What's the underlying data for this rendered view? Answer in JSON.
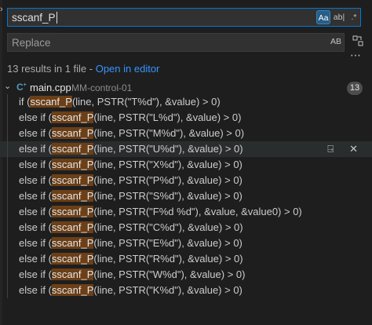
{
  "search": {
    "value": "sscanf_P",
    "options": [
      "Aa",
      "ab|",
      ".*"
    ]
  },
  "replace": {
    "placeholder": "Replace",
    "preserve_case": "AB"
  },
  "summary": {
    "text": "13 results in 1 file - ",
    "link": "Open in editor"
  },
  "file": {
    "name": "main.cpp",
    "path": "MM-control-01",
    "count": "13",
    "icon": "cpp-file-icon"
  },
  "results": [
    {
      "prefix": "if (",
      "match": "sscanf_P",
      "suffix": "(line, PSTR(\"T%d\"), &value) > 0)"
    },
    {
      "prefix": "else if (",
      "match": "sscanf_P",
      "suffix": "(line, PSTR(\"L%d\"), &value) > 0)"
    },
    {
      "prefix": "else if (",
      "match": "sscanf_P",
      "suffix": "(line, PSTR(\"M%d\"), &value) > 0)"
    },
    {
      "prefix": "else if (",
      "match": "sscanf_P",
      "suffix": "(line, PSTR(\"U%d\"), &value) > 0)"
    },
    {
      "prefix": "else if (",
      "match": "sscanf_P",
      "suffix": "(line, PSTR(\"X%d\"), &value) > 0)"
    },
    {
      "prefix": "else if (",
      "match": "sscanf_P",
      "suffix": "(line, PSTR(\"P%d\"), &value) > 0)"
    },
    {
      "prefix": "else if (",
      "match": "sscanf_P",
      "suffix": "(line, PSTR(\"S%d\"), &value) > 0)"
    },
    {
      "prefix": "else if (",
      "match": "sscanf_P",
      "suffix": "(line, PSTR(\"F%d %d\"), &value, &value0) > 0)"
    },
    {
      "prefix": "else if (",
      "match": "sscanf_P",
      "suffix": "(line, PSTR(\"C%d\"), &value) > 0)"
    },
    {
      "prefix": "else if (",
      "match": "sscanf_P",
      "suffix": "(line, PSTR(\"E%d\"), &value) > 0)"
    },
    {
      "prefix": "else if (",
      "match": "sscanf_P",
      "suffix": "(line, PSTR(\"R%d\"), &value) > 0)"
    },
    {
      "prefix": "else if (",
      "match": "sscanf_P",
      "suffix": "(line, PSTR(\"W%d\"), &value) > 0)"
    },
    {
      "prefix": "else if (",
      "match": "sscanf_P",
      "suffix": "(line, PSTR(\"K%d\"), &value) > 0)"
    }
  ],
  "colors": {
    "match_highlight": "#6b3f17",
    "focus_border": "#0078d4",
    "link": "#3794ff"
  }
}
